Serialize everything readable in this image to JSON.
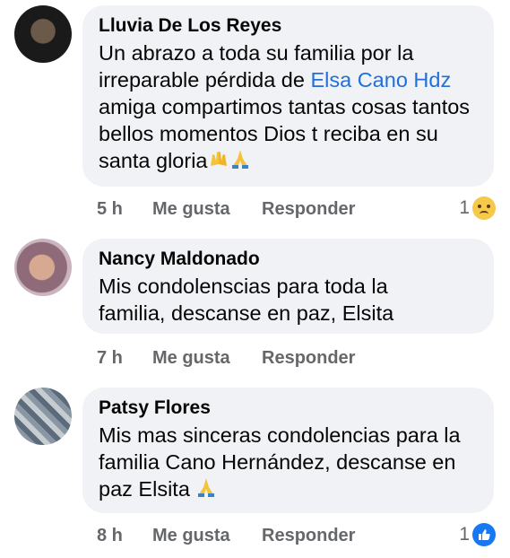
{
  "comments": [
    {
      "author": "Lluvia De Los Reyes",
      "text_before": "Un abrazo a toda su familia por la irreparable pérdida de ",
      "mention": "Elsa Cano Hdz",
      "text_after": " amiga compartimos tantas cosas tantos bellos momentos Dios t reciba en su santa gloria",
      "time": "5 h",
      "like_label": "Me gusta",
      "reply_label": "Responder",
      "reaction_count": "1",
      "reaction_icon": "sad-face-icon"
    },
    {
      "author": "Nancy Maldonado",
      "text": "Mis condolenscias para toda la familia, descanse en paz, Elsita",
      "time": "7 h",
      "like_label": "Me gusta",
      "reply_label": "Responder"
    },
    {
      "author": "Patsy Flores",
      "text": "Mis mas sinceras condolencias para la familia Cano Hernández, descanse en paz Elsita ",
      "time": "8 h",
      "like_label": "Me gusta",
      "reply_label": "Responder",
      "reaction_count": "1",
      "reaction_icon": "thumbs-up-icon"
    }
  ],
  "colors": {
    "bubble": "#f0f2f5",
    "mention": "#216fdb",
    "meta": "#65676b",
    "like_blue": "#1877f2"
  }
}
